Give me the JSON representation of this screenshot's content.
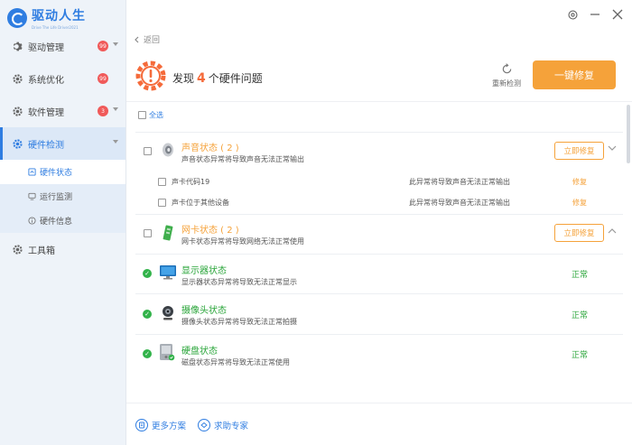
{
  "app": {
    "title": "驱动人生",
    "subtitle": "Drive The Life Driver2021"
  },
  "colors": {
    "brand": "#2f7de1",
    "warning": "#f5a23a",
    "ok": "#2aa53a",
    "badge": "#f05a5a"
  },
  "sidebar": {
    "items": [
      {
        "label": "驱动管理",
        "icon": "gear-icon",
        "badge": "99"
      },
      {
        "label": "系统优化",
        "icon": "gear-icon",
        "badge": "99"
      },
      {
        "label": "软件管理",
        "icon": "gear-icon",
        "badge": "3"
      },
      {
        "label": "硬件检测",
        "icon": "gear-icon"
      },
      {
        "label": "工具箱",
        "icon": "gear-icon"
      }
    ],
    "sub_items": [
      {
        "label": "硬件状态",
        "icon": "hardware-status-icon"
      },
      {
        "label": "运行监测",
        "icon": "monitor-icon"
      },
      {
        "label": "硬件信息",
        "icon": "info-icon"
      }
    ]
  },
  "header": {
    "back_label": "返回",
    "found_prefix": "发现",
    "found_count": "4",
    "found_suffix": "个硬件问题",
    "rescan_label": "重新检测",
    "fix_all_label": "一键修复"
  },
  "select_all_label": "全选",
  "groups": [
    {
      "title": "声音状态 ( 2 )",
      "desc": "声音状态异常将导致声音无法正常输出",
      "icon": "speaker-icon",
      "fix_label": "立即修复",
      "rows": [
        {
          "name": "声卡代码19",
          "desc": "此异常将导致声音无法正常输出",
          "action": "修复"
        },
        {
          "name": "声卡位于其他设备",
          "desc": "此异常将导致声音无法正常输出",
          "action": "修复"
        }
      ]
    },
    {
      "title": "网卡状态 ( 2 )",
      "desc": "网卡状态异常将导致网络无法正常使用",
      "icon": "network-card-icon",
      "fix_label": "立即修复"
    }
  ],
  "ok_items": [
    {
      "title": "显示器状态",
      "desc": "显示器状态异常将导致无法正常显示",
      "status": "正常",
      "icon": "monitor-display-icon"
    },
    {
      "title": "摄像头状态",
      "desc": "摄像头状态异常将导致无法正常拍摄",
      "status": "正常",
      "icon": "webcam-icon"
    },
    {
      "title": "硬盘状态",
      "desc": "磁盘状态异常将导致无法正常使用",
      "status": "正常",
      "icon": "hard-disk-icon"
    }
  ],
  "footer": {
    "more_solutions": "更多方案",
    "ask_expert": "求助专家"
  }
}
